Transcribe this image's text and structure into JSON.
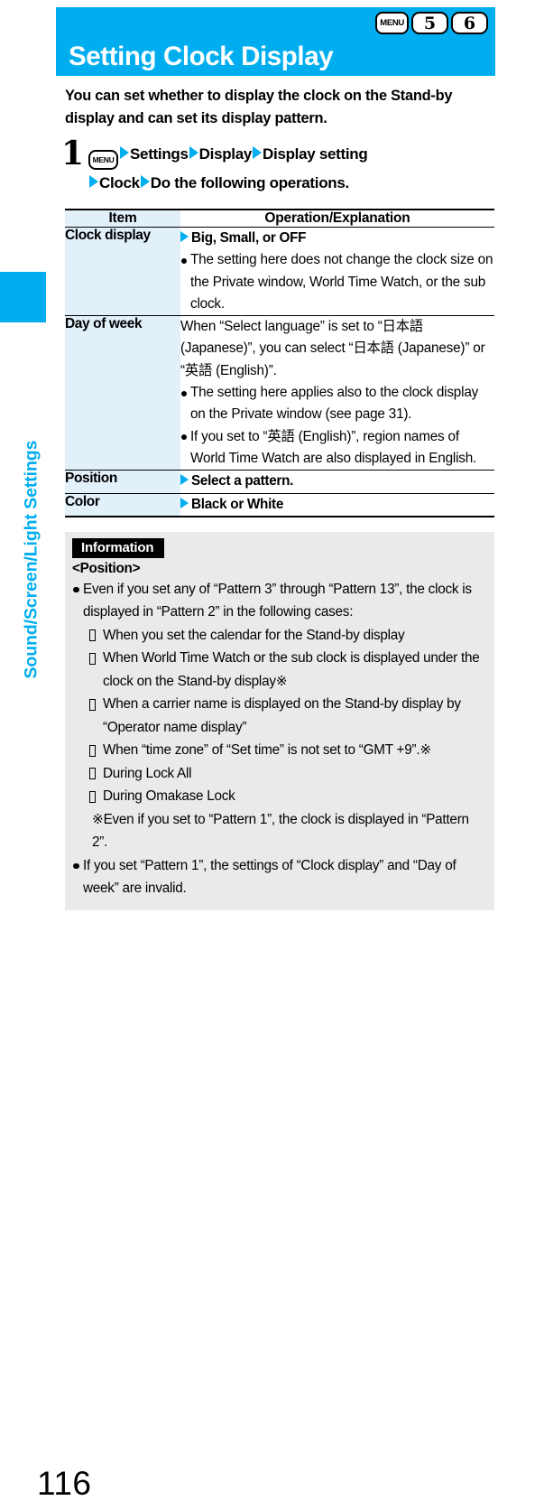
{
  "side_index": {
    "label": "Sound/Screen/Light Settings"
  },
  "banner": {
    "title": "Setting Clock Display",
    "keys": [
      {
        "icon": "menu-key-icon",
        "label": "MENU"
      },
      {
        "icon": "number-key-icon",
        "label": "5"
      },
      {
        "icon": "number-key-icon",
        "label": "6"
      }
    ]
  },
  "intro": {
    "text": "You can set whether to display the clock on the Stand-by display and can set its display pattern."
  },
  "step": {
    "number": "1",
    "menu_key_label": "MENU",
    "line1_part1": "Settings",
    "line1_part2": "Display",
    "line1_part3": "Display setting",
    "line2_part1": "Clock",
    "line2_part2": "Do the following operations."
  },
  "table": {
    "headers": [
      "Item",
      "Operation/Explanation"
    ],
    "rows": [
      {
        "item": "Clock display",
        "lead": "Big, Small, or OFF",
        "paragraph": "",
        "bullets": [
          "The setting here does not change the clock size on the Private window, World Time Watch, or the sub clock."
        ]
      },
      {
        "item": "Day of week",
        "lead": "",
        "paragraph": "When “Select language” is set to “日本語 (Japanese)”, you can select “日本語 (Japanese)” or “英語 (English)”.",
        "bullets": [
          "The setting here applies also to the clock display on the Private window (see page 31).",
          "If you set to “英語 (English)”, region names of World Time Watch are also displayed in English."
        ]
      },
      {
        "item": "Position",
        "lead": "Select a pattern.",
        "paragraph": "",
        "bullets": []
      },
      {
        "item": "Color",
        "lead": "Black or White",
        "paragraph": "",
        "bullets": []
      }
    ]
  },
  "information": {
    "tag": "Information",
    "subheading": "<Position>",
    "bullet1": "Even if you set any of “Pattern 3” through “Pattern 13”, the clock is displayed in “Pattern 2” in the following cases:",
    "sub_items": [
      "When you set the calendar for the Stand-by display",
      "When World Time Watch or the sub clock is displayed under the clock on the Stand-by display※",
      "When a carrier name is displayed on the Stand-by display by “Operator name display”",
      "When “time zone” of “Set time” is not set to “GMT +9”.※",
      "During Lock All",
      "During Omakase Lock"
    ],
    "note_mark": "※",
    "note": "Even if you set to “Pattern 1”, the clock is displayed in “Pattern 2”.",
    "bullet2": "If you set “Pattern 1”, the settings of “Clock display” and “Day of week” are invalid."
  },
  "page": {
    "number": "116"
  },
  "colors": {
    "accent_cyan": "#00AEEF",
    "item_column_bg": "#E2F0FA",
    "info_box_bg": "#EAEAEA"
  }
}
